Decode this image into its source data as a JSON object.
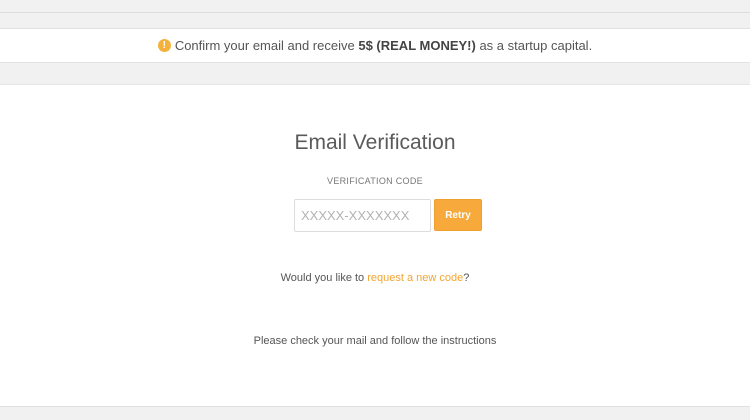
{
  "notice": {
    "icon": "exclamation-circle-icon",
    "text_before": "Confirm your email and receive ",
    "text_bold": "5$ (REAL MONEY!)",
    "text_after": " as a startup capital.",
    "icon_color": "#f4b23c"
  },
  "verification": {
    "title": "Email Verification",
    "code_label": "VERIFICATION CODE",
    "code_value": "",
    "code_placeholder": "XXXXX-XXXXXXX",
    "retry_label": "Retry",
    "request_before": "Would you like to ",
    "request_link": "request a new code",
    "request_after": "?",
    "instructions": "Please check your mail and follow the instructions"
  },
  "colors": {
    "accent": "#f7a93b",
    "link": "#f3a532",
    "background": "#f1f1f1",
    "panel": "#ffffff"
  }
}
